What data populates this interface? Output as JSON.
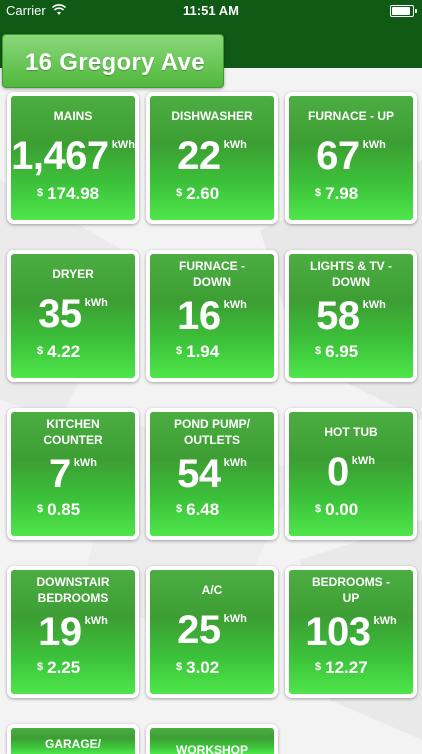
{
  "status_bar": {
    "carrier": "Carrier",
    "time": "11:51 AM"
  },
  "header": {
    "address": "16 Gregory Ave"
  },
  "currency_symbol": "$",
  "unit": "kWh",
  "colors": {
    "header_green": "#0f5a14",
    "tile_green": "#3cc13a",
    "tab_green": "#6cc85a"
  },
  "tiles": [
    {
      "name": "MAINS",
      "kwh": "1,467",
      "cost": "174.98"
    },
    {
      "name": "DISHWASHER",
      "kwh": "22",
      "cost": "2.60"
    },
    {
      "name": "FURNACE - UP",
      "kwh": "67",
      "cost": "7.98"
    },
    {
      "name": "DRYER",
      "kwh": "35",
      "cost": "4.22"
    },
    {
      "name": "FURNACE - DOWN",
      "kwh": "16",
      "cost": "1.94"
    },
    {
      "name": "LIGHTS & TV - DOWN",
      "kwh": "58",
      "cost": "6.95"
    },
    {
      "name": "KITCHEN COUNTER",
      "kwh": "7",
      "cost": "0.85"
    },
    {
      "name": "POND PUMP/ OUTLETS",
      "kwh": "54",
      "cost": "6.48"
    },
    {
      "name": "HOT TUB",
      "kwh": "0",
      "cost": "0.00"
    },
    {
      "name": "DOWNSTAIR BEDROOMS",
      "kwh": "19",
      "cost": "2.25"
    },
    {
      "name": "A/C",
      "kwh": "25",
      "cost": "3.02"
    },
    {
      "name": "BEDROOMS - UP",
      "kwh": "103",
      "cost": "12.27"
    },
    {
      "name": "GARAGE/",
      "kwh": "",
      "cost": ""
    },
    {
      "name": "WORKSHOP",
      "kwh": "",
      "cost": ""
    }
  ]
}
